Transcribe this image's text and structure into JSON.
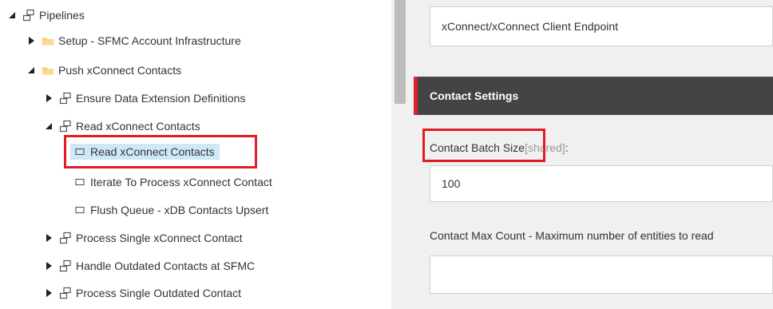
{
  "tree": {
    "root": {
      "label": "Pipelines"
    },
    "items": [
      {
        "label": "Setup - SFMC Account Infrastructure"
      },
      {
        "label": "Push xConnect Contacts"
      },
      {
        "label": "Ensure Data Extension Definitions"
      },
      {
        "label": "Read xConnect Contacts"
      },
      {
        "label": "Read xConnect Contacts",
        "selected": true
      },
      {
        "label": "Iterate To Process xConnect Contact"
      },
      {
        "label": "Flush Queue - xDB Contacts Upsert"
      },
      {
        "label": "Process Single xConnect Contact"
      },
      {
        "label": "Handle Outdated Contacts at SFMC"
      },
      {
        "label": "Process Single Outdated Contact"
      }
    ]
  },
  "form": {
    "endpoint_value": "xConnect/xConnect Client Endpoint",
    "section_title": "Contact Settings",
    "batch_size": {
      "label": "Contact Batch Size",
      "shared": "[shared]",
      "suffix": ":",
      "value": "100"
    },
    "max_count": {
      "label": "Contact Max Count - Maximum number of entities to read",
      "value": ""
    }
  },
  "colors": {
    "highlight_box": "#e01c24",
    "section_bg": "#444444",
    "section_accent": "#d8232a",
    "selection_bg": "#cfe8f7",
    "folder": "#f5c66b"
  },
  "icons": {
    "expanded": "triangle-expanded-icon",
    "collapsed": "triangle-collapsed-icon",
    "folder": "folder-icon",
    "pipeline": "pipeline-icon",
    "processor": "processor-icon"
  }
}
